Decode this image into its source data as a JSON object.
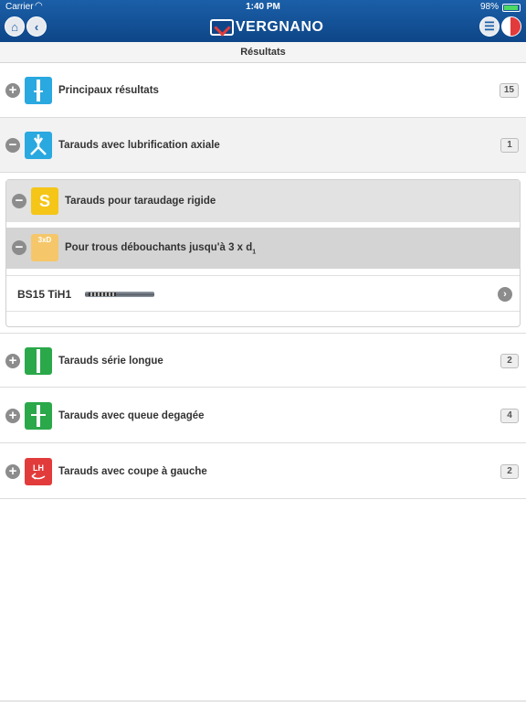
{
  "status": {
    "carrier": "Carrier",
    "time": "1:40 PM",
    "battery": "98%"
  },
  "header": {
    "brand": "VERGNANO"
  },
  "title": "Résultats",
  "groups": [
    {
      "label": "Principaux résultats",
      "count": "15"
    },
    {
      "label": "Tarauds avec lubrification axiale",
      "count": "1"
    },
    {
      "label": "Tarauds série longue",
      "count": "2"
    },
    {
      "label": "Tarauds avec queue degagée",
      "count": "4"
    },
    {
      "label": "Tarauds avec coupe à gauche",
      "count": "2"
    }
  ],
  "subgroups": [
    {
      "label": "Tarauds pour taraudage rigide",
      "icon_text": "S"
    },
    {
      "label": "Pour trous débouchants jusqu'à 3 x d",
      "subscript": "1",
      "icon_text": "3xD"
    }
  ],
  "product": {
    "name": "BS15 TiH1",
    "feature_icons": [
      {
        "name": "material-orange-icon",
        "text": "",
        "color": "#e8892a"
      },
      {
        "name": "thread-form-icon",
        "text": "",
        "color": "#b0202a"
      },
      {
        "name": "hssk-icon",
        "text": "HSSK",
        "color": "#e23b3b"
      },
      {
        "name": "tolerance-icon",
        "text": "6HX",
        "color": "#77b83e"
      },
      {
        "name": "chamfer-icon",
        "text": "B (4-5)",
        "color": "#5ab4e5"
      },
      {
        "name": "right-hand-icon",
        "text": "RH",
        "color": "#1f64b4"
      },
      {
        "name": "axial-coolant-icon",
        "text": "",
        "color": "#3aa1de"
      },
      {
        "name": "depth-icon",
        "text": "",
        "color": "#e23b3b"
      },
      {
        "name": "spiral-icon",
        "text": "",
        "color": "#e23b3b"
      }
    ]
  },
  "icons": {
    "group_colors": [
      "#2aa8e0",
      "#2aa8e0",
      "#2aa84a",
      "#2aa84a",
      "#e23b3b"
    ],
    "group_icon_text": [
      "",
      "",
      "",
      "",
      "LH"
    ],
    "subgroup_colors": [
      "#f5c518",
      "#f5c76a"
    ]
  }
}
